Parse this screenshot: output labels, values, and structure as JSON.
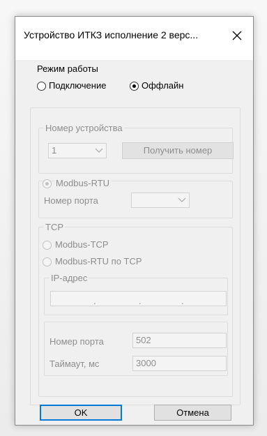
{
  "window": {
    "title": "Устройство ИТКЗ исполнение 2 верс...",
    "close_icon": "close-icon"
  },
  "mode": {
    "label": "Режим работы",
    "options": [
      {
        "label": "Подключение",
        "checked": false
      },
      {
        "label": "Оффлайн",
        "checked": true
      }
    ]
  },
  "device_number": {
    "label": "Номер устройства",
    "value": "1",
    "get_button": "Получить номер"
  },
  "modbus_rtu": {
    "label": "Modbus-RTU",
    "checked": true,
    "port_label": "Номер порта",
    "port_value": ""
  },
  "tcp": {
    "label": "TCP",
    "options": [
      {
        "label": "Modbus-TCP",
        "checked": false
      },
      {
        "label": "Modbus-RTU по TCP",
        "checked": false
      }
    ],
    "ip_label": "IP-адрес",
    "ip_value": ".       .       .",
    "port_label": "Номер порта",
    "port_value": "502",
    "timeout_label": "Таймаут, мс",
    "timeout_value": "3000"
  },
  "buttons": {
    "ok": "OK",
    "cancel": "Отмена"
  },
  "colors": {
    "accent": "#0078d7",
    "disabled_text": "#8d8d8d",
    "background": "#f0f0f0"
  }
}
